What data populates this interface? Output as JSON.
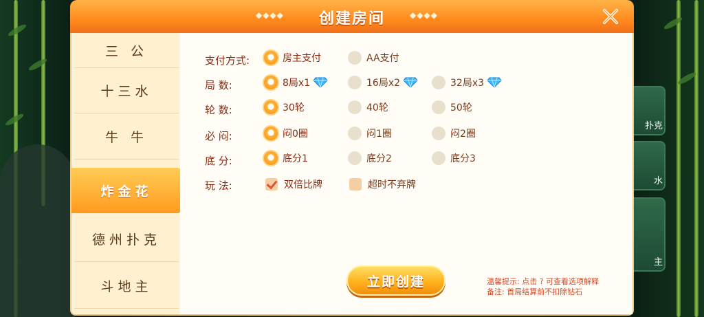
{
  "dialog": {
    "title": "创建房间",
    "deco_left": "◆◆◆◆",
    "deco_right": "◆◆◆◆"
  },
  "sidebar": {
    "tabs": [
      {
        "label": "三 公"
      },
      {
        "label": "十三水"
      },
      {
        "label": "牛 牛"
      },
      {
        "label": "炸金花",
        "active": true
      },
      {
        "label": "德州扑克"
      },
      {
        "label": "斗地主"
      }
    ]
  },
  "options": {
    "payment": {
      "label": "支付方式:",
      "choices": [
        "房主支付",
        "AA支付"
      ],
      "selected": 0
    },
    "rounds": {
      "label": "局 数:",
      "choices": [
        "8局x1",
        "16局x2",
        "32局x3"
      ],
      "selected": 0
    },
    "turns": {
      "label": "轮 数:",
      "choices": [
        "30轮",
        "40轮",
        "50轮"
      ],
      "selected": 0
    },
    "must_stuffy": {
      "label": "必 闷:",
      "choices": [
        "闷0圈",
        "闷1圈",
        "闷2圈"
      ],
      "selected": 0
    },
    "base_score": {
      "label": "底 分:",
      "choices": [
        "底分1",
        "底分2",
        "底分3"
      ],
      "selected": 0
    },
    "play": {
      "label": "玩 法:",
      "choices": [
        "双倍比牌",
        "超时不弃牌"
      ],
      "checked": [
        true,
        false
      ]
    }
  },
  "actions": {
    "create_label": "立即创建"
  },
  "tips": {
    "line1": "温馨提示: 点击 ? 可查看选项解释",
    "line2": "备注: 首局结算前不扣除钻石"
  },
  "background": {
    "side_labels": [
      "扑克",
      "水",
      "主"
    ]
  },
  "colors": {
    "accent": "#ff9b1f",
    "label": "#8b2a10",
    "tip": "#d24b2a"
  }
}
